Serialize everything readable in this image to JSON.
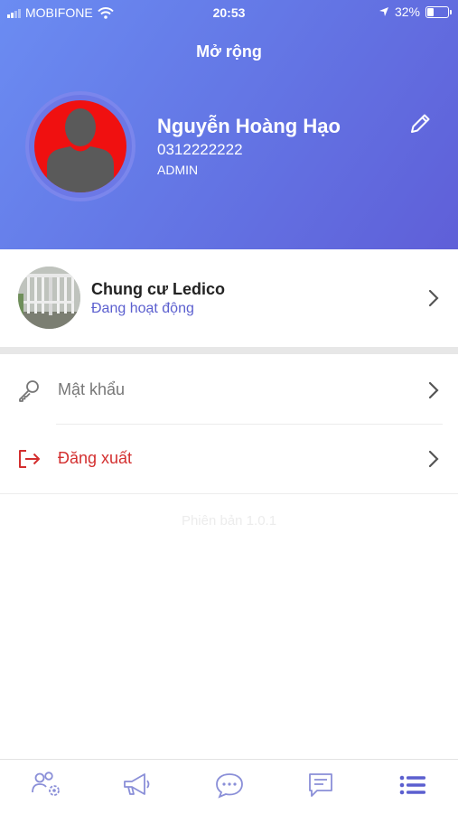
{
  "status_bar": {
    "carrier": "MOBIFONE",
    "time": "20:53",
    "battery": "32%"
  },
  "header": {
    "title": "Mở rộng"
  },
  "profile": {
    "name": "Nguyễn Hoàng Hạo",
    "phone": "0312222222",
    "role": "ADMIN"
  },
  "building": {
    "name": "Chung cư Ledico",
    "status": "Đang hoạt động"
  },
  "menu": [
    {
      "label": "Mật khẩu",
      "icon": "key-icon",
      "color": "#777777"
    },
    {
      "label": "Đăng xuất",
      "icon": "logout-icon",
      "color": "#d32f2f"
    }
  ],
  "version": "Phiên bản 1.0.1",
  "tabs": [
    {
      "icon": "users-settings-icon",
      "active": false
    },
    {
      "icon": "megaphone-icon",
      "active": false
    },
    {
      "icon": "chat-bubble-icon",
      "active": false
    },
    {
      "icon": "feedback-icon",
      "active": false
    },
    {
      "icon": "menu-list-icon",
      "active": true
    }
  ],
  "colors": {
    "accent": "#5b5fcf",
    "inactive_tab": "#8a8fd8",
    "danger": "#d32f2f"
  }
}
